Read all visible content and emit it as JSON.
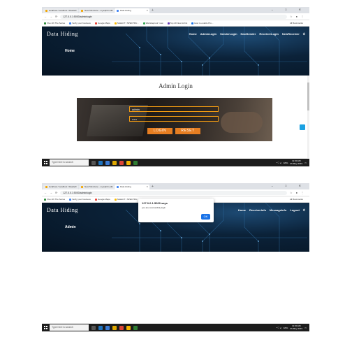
{
  "browser": {
    "tabs": [
      "localhost / localhost / Reader",
      "New Tab Alone - mysqlrnb.exe",
      "Data Hiding"
    ],
    "url": "127.0.0.1:5000/adminlogin",
    "window_controls": "– □ ✕",
    "bookmarks": [
      "Vivo 4th The Series",
      "Verify your business",
      "Google Maps",
      "SELECT / SPECTRU...",
      "Websiteproof: now",
      "Top 20 New Ad list",
      "How to enable Pro...",
      "localhost/phpMyA..."
    ],
    "other_bookmarks": "All Bookmarks"
  },
  "site": {
    "brand": "Data Hiding",
    "nav_shot1": [
      "Home",
      "AdminLogin",
      "SenderLogin",
      "NewSender",
      "ReceiverLogin",
      "NewReceiver"
    ],
    "nav_shot2": [
      "Home",
      "ReceiverInfo",
      "MessageInfo",
      "Logout"
    ],
    "hero_shot1": "Home",
    "hero_shot2": "Admin"
  },
  "login": {
    "title": "Admin Login",
    "username": "admin",
    "password": "•••••",
    "login_label": "LOGIN",
    "reset_label": "RESET"
  },
  "dialog": {
    "title": "127.0.0.1:5000 says",
    "message": "you are successfully login",
    "ok_label": "OK"
  },
  "taskbar": {
    "search_placeholder": "Type here to search",
    "time": "11:30 AM",
    "date": "06-May-2019",
    "lang": "ENG"
  },
  "colors": {
    "accent": "#e67e22",
    "hero_dark": "#061423",
    "dialog_ok": "#1a73e8"
  }
}
